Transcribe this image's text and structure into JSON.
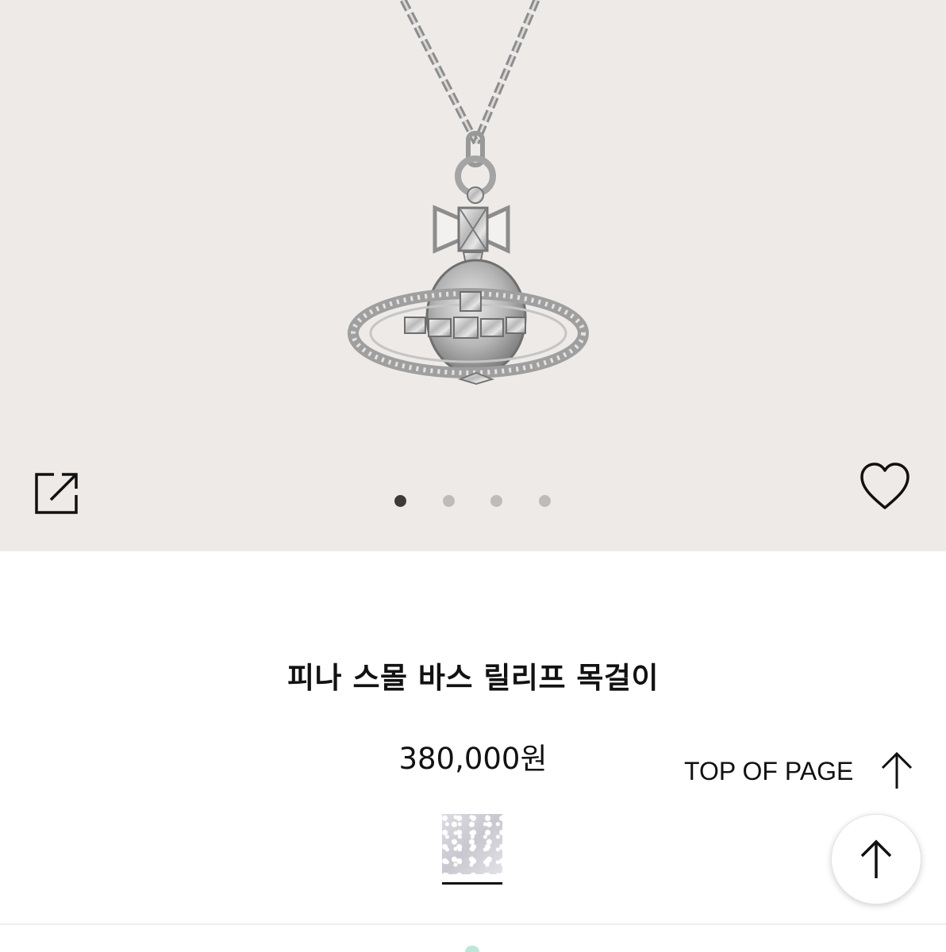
{
  "product": {
    "title": "피나 스몰 바스 릴리프 목걸이",
    "price": "380,000원"
  },
  "gallery": {
    "total_images": 4,
    "active_index": 0
  },
  "actions": {
    "share_icon": "share-icon",
    "wishlist_icon": "heart-icon",
    "scroll_top_icon": "arrow-up-icon"
  },
  "top_of_page": {
    "label": "TOP OF PAGE"
  },
  "colors": {
    "hero_background": "#edeae8",
    "dot_active": "#3b3b3b",
    "dot_inactive": "#bdbcbb"
  }
}
